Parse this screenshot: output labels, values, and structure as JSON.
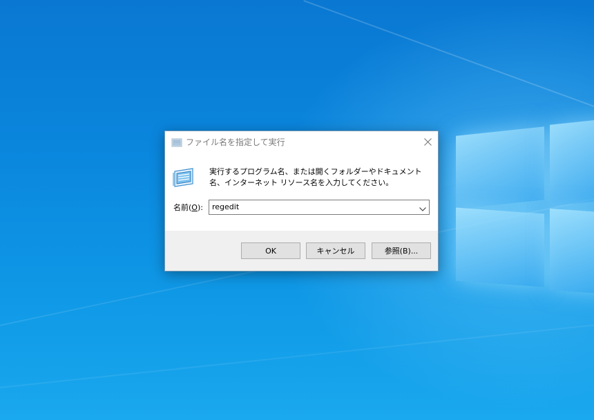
{
  "dialog": {
    "title": "ファイル名を指定して実行",
    "description": "実行するプログラム名、または開くフォルダーやドキュメント名、インターネット リソース名を入力してください。",
    "open_label_prefix": "名前(",
    "open_label_mnemonic": "O",
    "open_label_suffix": "):",
    "open_value": "regedit",
    "buttons": {
      "ok": "OK",
      "cancel": "キャンセル",
      "browse": "参照(B)..."
    }
  },
  "icons": {
    "title_icon": "run-icon",
    "run_icon": "run-icon",
    "close": "close-icon",
    "dropdown": "chevron-down-icon"
  },
  "colors": {
    "desktop": "#0a86dd",
    "dialog_footer": "#f0f0f0",
    "button_face": "#e1e1e1"
  }
}
